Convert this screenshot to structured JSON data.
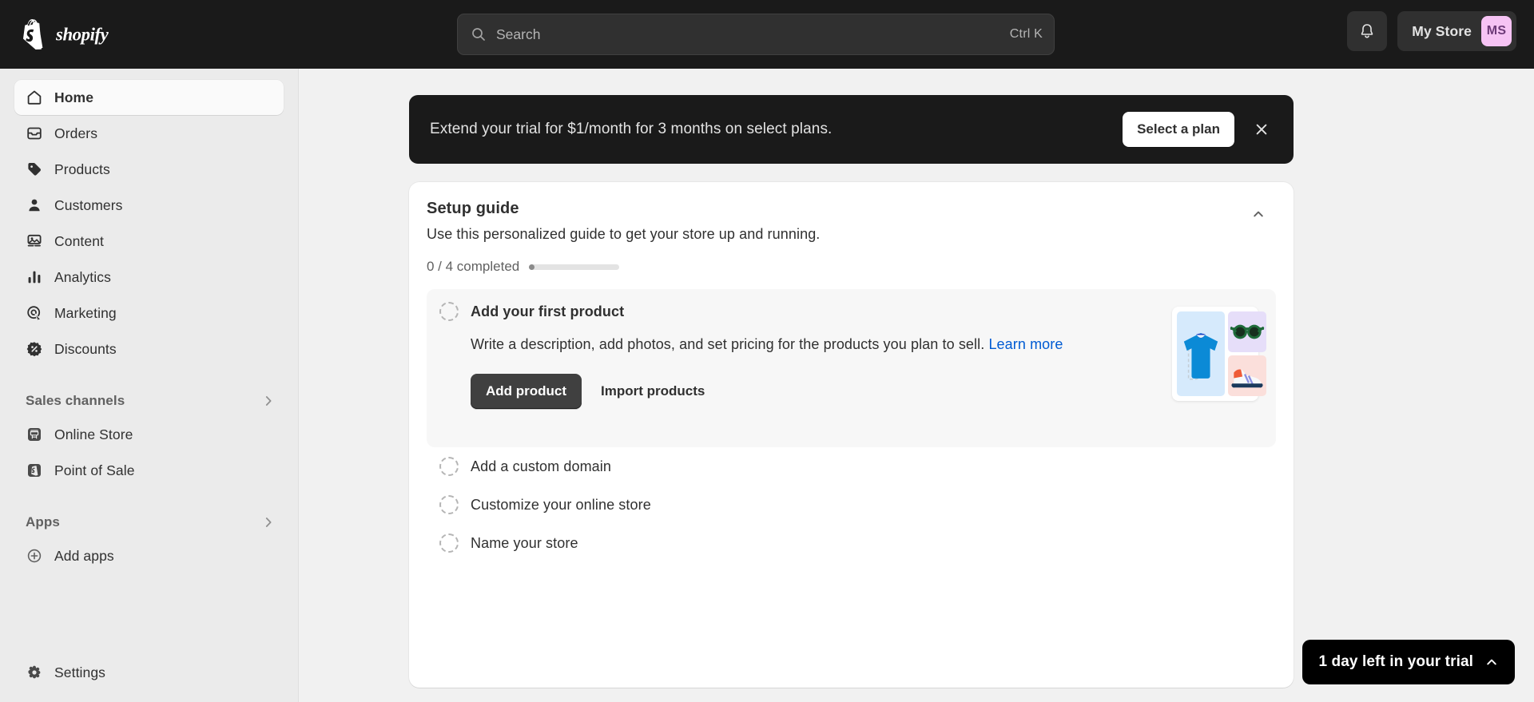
{
  "topbar": {
    "brand": "shopify",
    "search": {
      "placeholder": "Search",
      "shortcut": "Ctrl K",
      "icon": "search-icon"
    },
    "notifications_icon": "bell-icon",
    "store_name": "My Store",
    "avatar_initials": "MS",
    "avatar_bg": "#f6c3f4",
    "avatar_fg": "#6d3a78",
    "bg": "#1a1a1a"
  },
  "sidebar": {
    "bg": "#ebebeb",
    "items": [
      {
        "label": "Home",
        "icon": "home-icon",
        "active": true
      },
      {
        "label": "Orders",
        "icon": "orders-icon",
        "active": false
      },
      {
        "label": "Products",
        "icon": "products-tag-icon",
        "active": false
      },
      {
        "label": "Customers",
        "icon": "customers-person-icon",
        "active": false
      },
      {
        "label": "Content",
        "icon": "content-image-icon",
        "active": false
      },
      {
        "label": "Analytics",
        "icon": "analytics-bars-icon",
        "active": false
      },
      {
        "label": "Marketing",
        "icon": "marketing-target-icon",
        "active": false
      },
      {
        "label": "Discounts",
        "icon": "discounts-percent-icon",
        "active": false
      }
    ],
    "sections": [
      {
        "label": "Sales channels",
        "chevron": "chevron-right-icon",
        "items": [
          {
            "label": "Online Store",
            "icon": "online-store-icon"
          },
          {
            "label": "Point of Sale",
            "icon": "point-of-sale-icon"
          }
        ]
      },
      {
        "label": "Apps",
        "chevron": "chevron-right-icon",
        "items": [
          {
            "label": "Add apps",
            "icon": "plus-circle-icon"
          }
        ]
      }
    ],
    "settings": {
      "label": "Settings",
      "icon": "gear-icon"
    }
  },
  "banner": {
    "text": "Extend your trial for $1/month for 3 months on select plans.",
    "cta_label": "Select a plan",
    "close_icon": "close-icon",
    "bg": "#1a1a1a"
  },
  "setup_guide": {
    "title": "Setup guide",
    "subtitle": "Use this personalized guide to get your store up and running.",
    "collapse_icon": "chevron-up-icon",
    "progress_label": "0 / 4 completed",
    "completed": 0,
    "total": 4,
    "tasks": [
      {
        "title": "Add your first product",
        "expanded": true,
        "description": "Write a description, add photos, and set pricing for the products you plan to sell.",
        "link_label": "Learn more",
        "link_color": "#005bd3",
        "primary_button": "Add product",
        "secondary_button": "Import products",
        "illustration": {
          "tiles": [
            {
              "name": "tshirt-illustration",
              "bg": "#d6eafc"
            },
            {
              "name": "sunglasses-illustration",
              "bg": "#e6def9"
            },
            {
              "name": "sneaker-illustration",
              "bg": "#fbdfdb"
            }
          ]
        }
      },
      {
        "title": "Add a custom domain",
        "expanded": false
      },
      {
        "title": "Customize your online store",
        "expanded": false
      },
      {
        "title": "Name your store",
        "expanded": false
      }
    ]
  },
  "trial_pill": {
    "label": "1 day left in your trial",
    "chevron": "chevron-up-icon",
    "bg": "#000000"
  }
}
